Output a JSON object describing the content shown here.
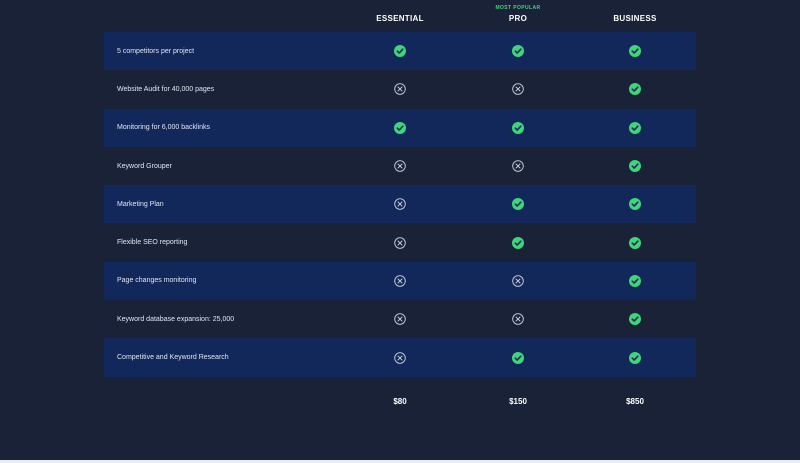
{
  "plans": [
    {
      "name": "ESSENTIAL",
      "badge": "",
      "price": "$80"
    },
    {
      "name": "PRO",
      "badge": "MOST POPULAR",
      "price": "$150"
    },
    {
      "name": "BUSINESS",
      "badge": "",
      "price": "$850"
    }
  ],
  "features": [
    {
      "label": "5 competitors per project",
      "included": [
        true,
        true,
        true
      ]
    },
    {
      "label": "Website Audit for 40,000 pages",
      "included": [
        false,
        false,
        true
      ]
    },
    {
      "label": "Monitoring for 6,000 backlinks",
      "included": [
        true,
        true,
        true
      ]
    },
    {
      "label": "Keyword Grouper",
      "included": [
        false,
        false,
        true
      ]
    },
    {
      "label": "Marketing Plan",
      "included": [
        false,
        true,
        true
      ]
    },
    {
      "label": "Flexible SEO reporting",
      "included": [
        false,
        true,
        true
      ]
    },
    {
      "label": "Page changes monitoring",
      "included": [
        false,
        false,
        true
      ]
    },
    {
      "label": "Keyword database expansion: 25,000",
      "included": [
        false,
        false,
        true
      ]
    },
    {
      "label": "Competitive and Keyword Research",
      "included": [
        false,
        true,
        true
      ]
    }
  ],
  "icons": {
    "included": "check-circle-icon",
    "excluded": "x-circle-icon"
  },
  "colors": {
    "background": "#1a2238",
    "row_shaded": "#13285a",
    "check": "#3fd67a",
    "badge": "#3fd67a",
    "cross_stroke": "#c9cfdb"
  }
}
